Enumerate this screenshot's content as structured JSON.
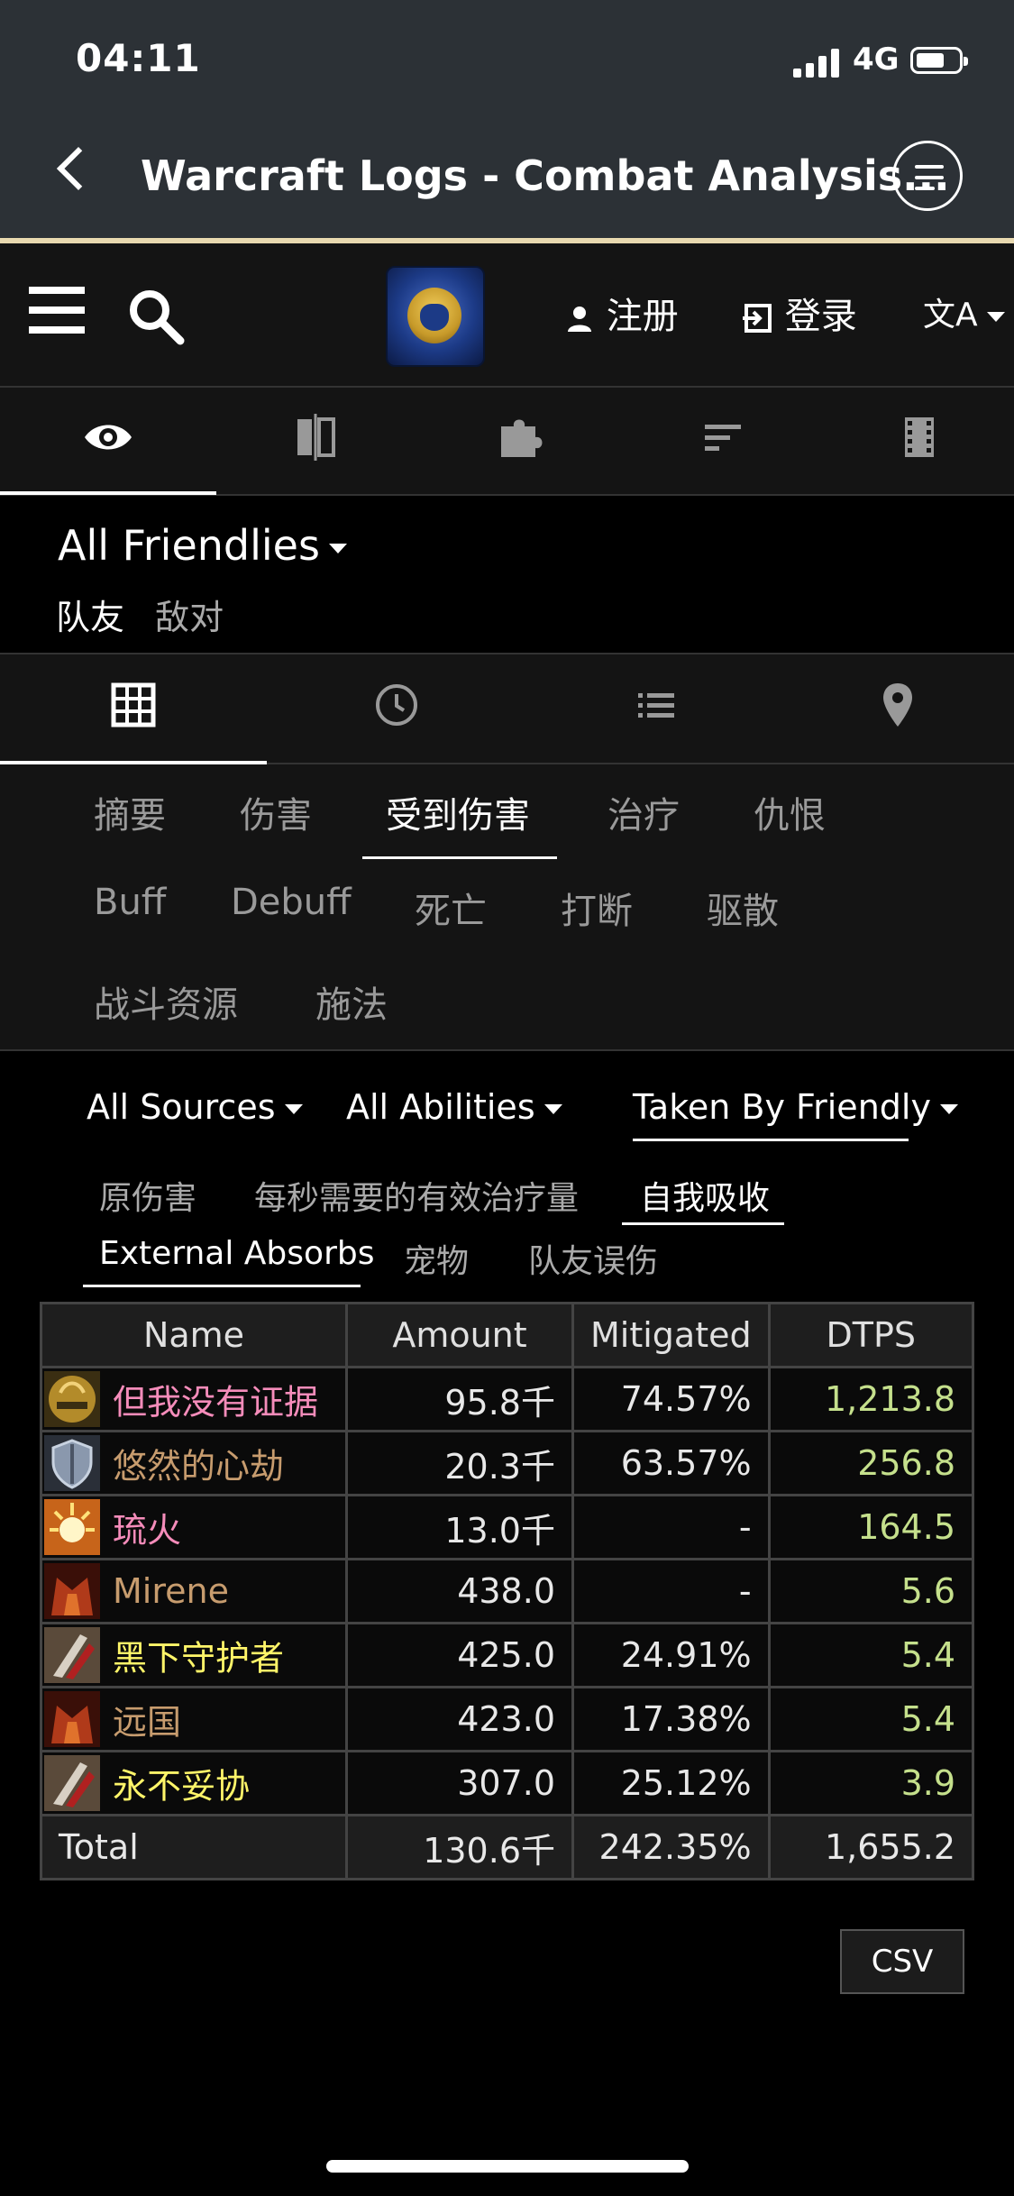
{
  "status": {
    "time": "04:11",
    "network": "4G"
  },
  "browser": {
    "title": "Warcraft Logs - Combat Analysis..."
  },
  "site_nav": {
    "register": "注册",
    "login": "登录",
    "lang": "文A"
  },
  "selector": {
    "title": "All Friendlies",
    "links": [
      "队友",
      "敌对"
    ]
  },
  "categories": [
    [
      "摘要",
      "伤害",
      "受到伤害",
      "治疗",
      "仇恨"
    ],
    [
      "Buff",
      "Debuff",
      "死亡",
      "打断",
      "驱散"
    ],
    [
      "战斗资源",
      "施法"
    ]
  ],
  "active_category": "受到伤害",
  "filters": {
    "sources": "All Sources",
    "abilities": "All Abilities",
    "taken_by": "Taken By Friendly"
  },
  "subtabs": {
    "row1": [
      "原伤害",
      "每秒需要的有效治疗量",
      "自我吸收"
    ],
    "row2": [
      "External Absorbs",
      "宠物",
      "队友误伤"
    ]
  },
  "table": {
    "headers": [
      "Name",
      "Amount",
      "Mitigated",
      "DTPS"
    ],
    "rows": [
      {
        "name": "但我没有证据",
        "amount": "95.8千",
        "mitigated": "74.57%",
        "dtps": "1,213.8",
        "color": "#f58cba",
        "icon": "paladin-helmet-icon"
      },
      {
        "name": "悠然的心劫",
        "amount": "20.3千",
        "mitigated": "63.57%",
        "dtps": "256.8",
        "color": "#c79c6e",
        "icon": "warrior-shield-icon"
      },
      {
        "name": "琉火",
        "amount": "13.0千",
        "mitigated": "-",
        "dtps": "164.5",
        "color": "#f58cba",
        "icon": "holy-light-icon"
      },
      {
        "name": "Mirene",
        "amount": "438.0",
        "mitigated": "-",
        "dtps": "5.6",
        "color": "#c79c6e",
        "icon": "warrior-helm-icon"
      },
      {
        "name": "黑下守护者",
        "amount": "425.0",
        "mitigated": "24.91%",
        "dtps": "5.4",
        "color": "#fff569",
        "icon": "rogue-blade-icon"
      },
      {
        "name": "远国",
        "amount": "423.0",
        "mitigated": "17.38%",
        "dtps": "5.4",
        "color": "#c79c6e",
        "icon": "warrior-helm-icon"
      },
      {
        "name": "永不妥协",
        "amount": "307.0",
        "mitigated": "25.12%",
        "dtps": "3.9",
        "color": "#fff569",
        "icon": "rogue-blade-icon"
      }
    ],
    "total": {
      "label": "Total",
      "amount": "130.6千",
      "mitigated": "242.35%",
      "dtps": "1,655.2"
    }
  },
  "csv_label": "CSV"
}
